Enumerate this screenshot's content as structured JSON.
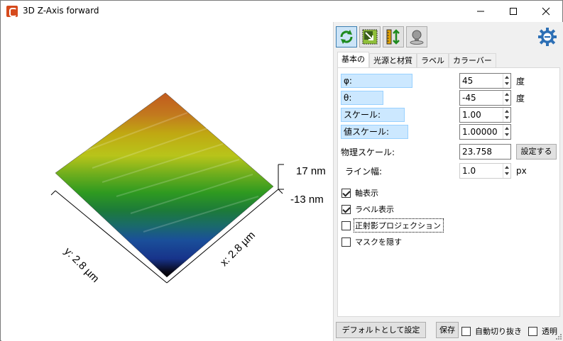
{
  "window": {
    "title": "3D Z-Axis forward",
    "icon": "gwyddion-app-icon"
  },
  "view": {
    "z_max_label": "17 nm",
    "z_min_label": "-13 nm",
    "y_axis_label": "y: 2.8 µm",
    "x_axis_label": "x: 2.8 µm",
    "colors": {
      "high": "#d2691e",
      "mid_high": "#c8b400",
      "mid": "#2e9a1e",
      "low": "#1e4f9a",
      "lowest": "#000000"
    }
  },
  "toolbar": {
    "rotate_icon": "rotate-icon",
    "scale_icon": "scale-icon",
    "zscale_icon": "z-scale-icon",
    "light_icon": "light-icon",
    "settings_icon": "gear-icon"
  },
  "tabs": [
    "基本の",
    "光源と材質",
    "ラベル",
    "カラーバー"
  ],
  "basic": {
    "phi_label": "φ:",
    "phi_value": "45",
    "phi_unit": "度",
    "theta_label": "θ:",
    "theta_value": "-45",
    "theta_unit": "度",
    "scale_label": "スケール:",
    "scale_value": "1.00",
    "value_scale_label": "値スケール:",
    "value_scale_value": "1.00000",
    "physical_scale_label": "物理スケール:",
    "physical_scale_value": "23.758",
    "set_button": "設定する",
    "line_width_label": "ライン幅:",
    "line_width_value": "1.0",
    "line_width_unit": "px",
    "show_axes_label": "軸表示",
    "show_axes_checked": true,
    "show_labels_label": "ラベル表示",
    "show_labels_checked": true,
    "ortho_label": "正射影プロジェクション",
    "ortho_checked": false,
    "hide_mask_label": "マスクを隠す",
    "hide_mask_checked": false
  },
  "footer": {
    "default_button": "デフォルトとして設定",
    "save_button": "保存",
    "autocrop_label": "自動切り抜き",
    "autocrop_checked": false,
    "transparent_label": "透明",
    "transparent_checked": false
  }
}
